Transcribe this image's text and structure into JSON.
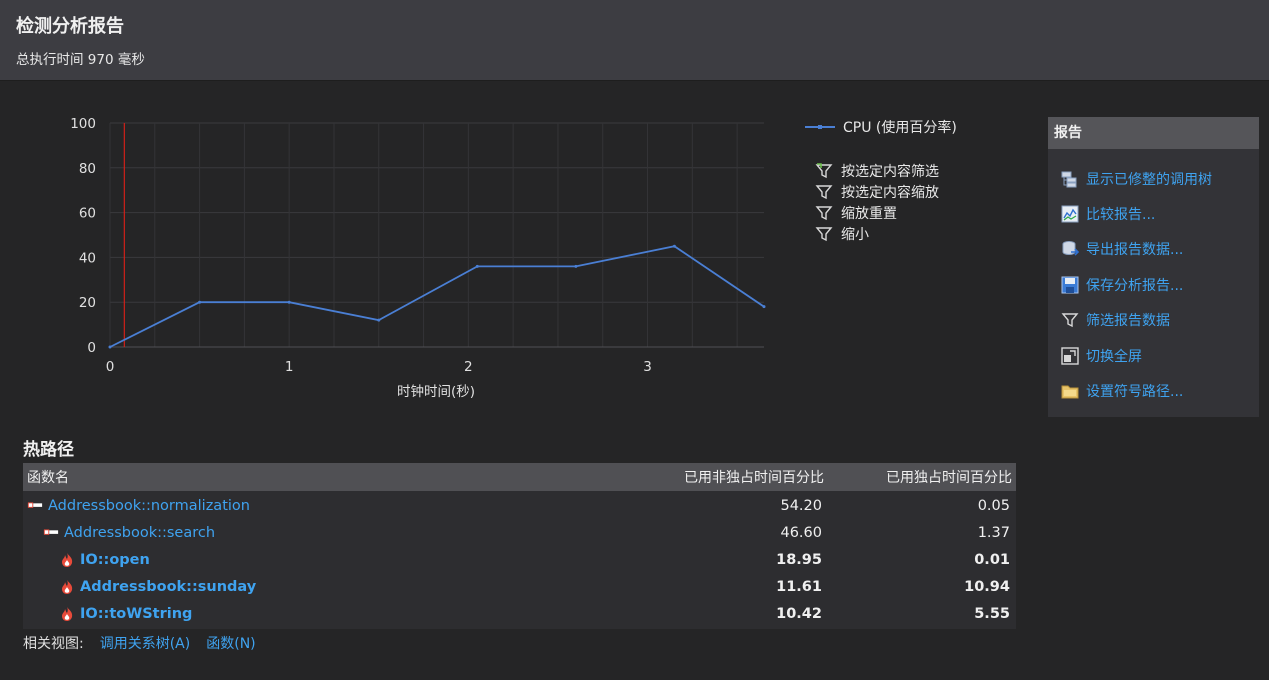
{
  "header": {
    "title": "检测分析报告",
    "subtitle": "总执行时间 970 毫秒"
  },
  "chart_data": {
    "type": "line",
    "xlabel": "时钟时间(秒)",
    "ylabel": "",
    "xlim": [
      0,
      3.65
    ],
    "ylim": [
      0,
      100
    ],
    "x_ticks": [
      0,
      1,
      2,
      3
    ],
    "y_ticks": [
      0,
      20,
      40,
      60,
      80,
      100
    ],
    "grid": true,
    "marker_x": 0.08,
    "series": [
      {
        "name": "CPU (使用百分率)",
        "color": "#4a7fd4",
        "x": [
          0,
          0.5,
          1.0,
          1.5,
          2.05,
          2.6,
          3.15,
          3.65
        ],
        "y": [
          0,
          20,
          20,
          12,
          36,
          36,
          45,
          18
        ]
      }
    ],
    "legend_position": "right"
  },
  "legend": {
    "series_label": "CPU (使用百分率)"
  },
  "chart_actions": [
    {
      "label": "按选定内容筛选",
      "icon": "filter-selection-icon"
    },
    {
      "label": "按选定内容缩放",
      "icon": "filter-icon"
    },
    {
      "label": "缩放重置",
      "icon": "filter-icon"
    },
    {
      "label": "缩小",
      "icon": "filter-icon"
    }
  ],
  "report_panel": {
    "title": "报告",
    "items": [
      {
        "label": "显示已修整的调用树",
        "icon": "call-tree-icon"
      },
      {
        "label": "比较报告...",
        "icon": "compare-icon"
      },
      {
        "label": "导出报告数据...",
        "icon": "export-icon"
      },
      {
        "label": "保存分析报告...",
        "icon": "save-icon"
      },
      {
        "label": "筛选报告数据",
        "icon": "filter-icon"
      },
      {
        "label": "切换全屏",
        "icon": "fullscreen-icon"
      },
      {
        "label": "设置符号路径...",
        "icon": "folder-icon"
      }
    ]
  },
  "hot_path": {
    "title": "热路径",
    "columns": [
      "函数名",
      "已用非独占时间百分比",
      "已用独占时间百分比"
    ],
    "rows": [
      {
        "name": "Addressbook::normalization",
        "inclusive": "54.20",
        "exclusive": "0.05",
        "indent": 0,
        "icon": "hot-path-icon",
        "bold": false
      },
      {
        "name": "Addressbook::search",
        "inclusive": "46.60",
        "exclusive": "1.37",
        "indent": 1,
        "icon": "hot-path-icon",
        "bold": false
      },
      {
        "name": "IO::open",
        "inclusive": "18.95",
        "exclusive": "0.01",
        "indent": 2,
        "icon": "flame-icon",
        "bold": true
      },
      {
        "name": "Addressbook::sunday",
        "inclusive": "11.61",
        "exclusive": "10.94",
        "indent": 2,
        "icon": "flame-icon",
        "bold": true
      },
      {
        "name": "IO::toWString",
        "inclusive": "10.42",
        "exclusive": "5.55",
        "indent": 2,
        "icon": "flame-icon",
        "bold": true
      }
    ]
  },
  "related_views": {
    "label": "相关视图:",
    "links": [
      "调用关系树(A)",
      "函数(N)"
    ]
  }
}
